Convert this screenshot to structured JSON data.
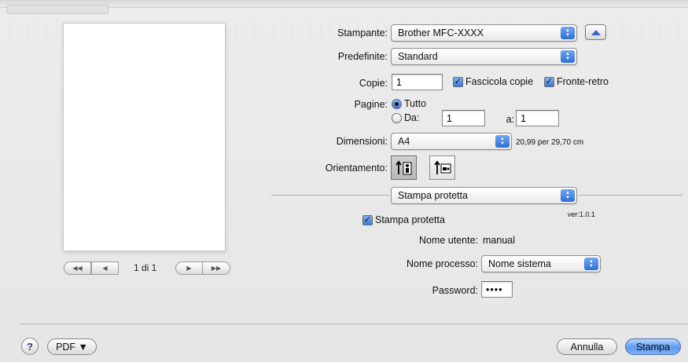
{
  "printer": {
    "label": "Stampante:",
    "value": "Brother MFC-XXXX"
  },
  "presets": {
    "label": "Predefinite:",
    "value": "Standard"
  },
  "copies": {
    "label": "Copie:",
    "value": "1",
    "collate_label": "Fascicola copie",
    "duplex_label": "Fronte-retro"
  },
  "pages": {
    "label": "Pagine:",
    "all_label": "Tutto",
    "from_label": "Da:",
    "from_value": "1",
    "to_label": "a:",
    "to_value": "1"
  },
  "size": {
    "label": "Dimensioni:",
    "value": "A4",
    "dimensions_text": "20,99 per 29,70 cm"
  },
  "orientation": {
    "label": "Orientamento:"
  },
  "section_popup": {
    "value": "Stampa protetta"
  },
  "secure": {
    "checkbox_label": "Stampa protetta",
    "version": "ver:1.0.1",
    "user_label": "Nome utente:",
    "user_value": "manual",
    "job_label": "Nome processo:",
    "job_value": "Nome sistema",
    "password_label": "Password:",
    "password_value": "••••"
  },
  "preview": {
    "page_indicator": "1 di 1"
  },
  "footer": {
    "help": "?",
    "pdf_label": "PDF ▼",
    "cancel_label": "Annulla",
    "print_label": "Stampa"
  }
}
